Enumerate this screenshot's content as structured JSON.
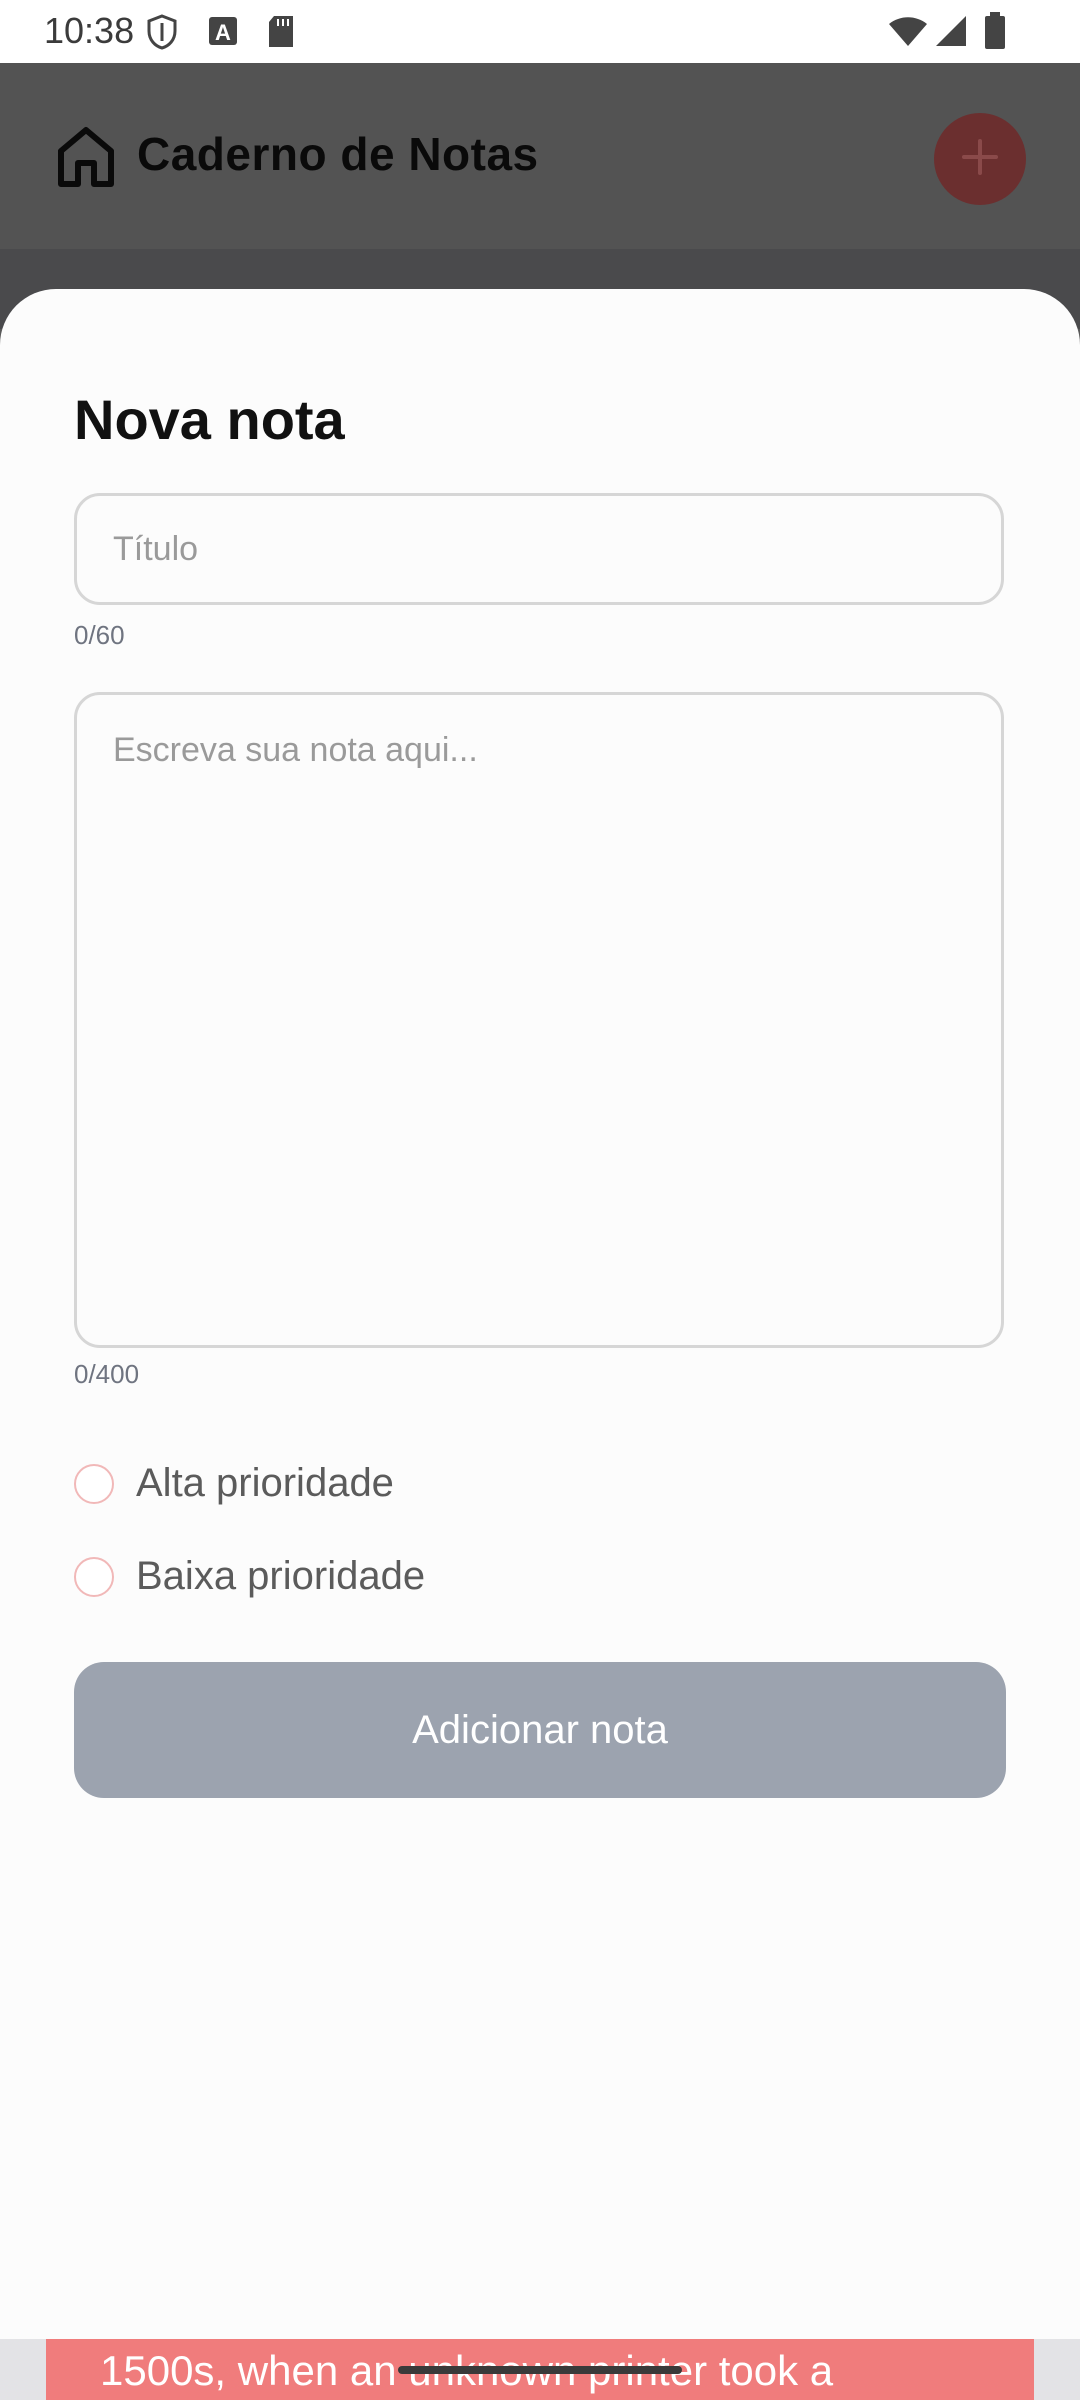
{
  "status_bar": {
    "time": "10:38",
    "left_icons": [
      "shield-icon",
      "text-a-icon",
      "sd-card-icon"
    ],
    "right_icons": [
      "wifi-icon",
      "signal-icon",
      "battery-icon"
    ]
  },
  "app_bar": {
    "title": "Caderno de Notas",
    "home_icon": "home-icon",
    "fab_icon": "plus-icon"
  },
  "sheet": {
    "title": "Nova nota",
    "title_input": {
      "value": "",
      "placeholder": "Título",
      "counter": "0/60"
    },
    "body_input": {
      "value": "",
      "placeholder": "Escreva sua nota aqui...",
      "counter": "0/400"
    },
    "priority_options": [
      {
        "label": "Alta prioridade",
        "selected": false
      },
      {
        "label": "Baixa prioridade",
        "selected": false
      }
    ],
    "submit_label": "Adicionar nota"
  },
  "peek": {
    "text": "1500s, when an unknown printer took a"
  },
  "colors": {
    "submit_button": "#9ca3af",
    "fab": "#6b2f2f",
    "radio_border": "#f1b8b8",
    "peek_card": "#f07c7c"
  }
}
